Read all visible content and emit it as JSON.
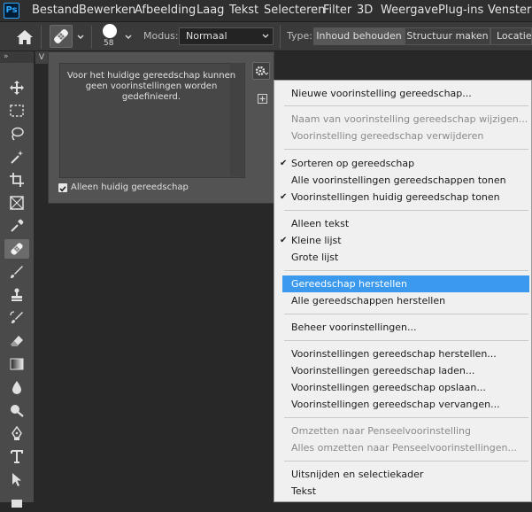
{
  "app": {
    "logo": "Ps"
  },
  "menubar": {
    "items": [
      "Bestand",
      "Bewerken",
      "Afbeelding",
      "Laag",
      "Tekst",
      "Selecteren",
      "Filter",
      "3D",
      "Weergave",
      "Plug-ins",
      "Venster"
    ]
  },
  "options": {
    "brush_size": "58",
    "mode_label": "Modus:",
    "mode_value": "Normaal",
    "type_label": "Type:",
    "type_buttons": [
      "Inhoud behouden",
      "Structuur maken",
      "Locatie a"
    ]
  },
  "toolbar": {
    "collapse_glyph": "»",
    "doc_tab_glyph": "V"
  },
  "preset_panel": {
    "message": "Voor het huidige gereedschap kunnen geen voorinstellingen worden gedefinieerd.",
    "checkbox_label": "Alleen huidig gereedschap",
    "checkbox_checked": true
  },
  "context_menu": {
    "items": [
      {
        "label": "Nieuwe voorinstelling gereedschap...",
        "disabled": false,
        "checked": false,
        "highlighted": false
      },
      {
        "label": "Naam van voorinstelling gereedschap wijzigen...",
        "disabled": true,
        "checked": false,
        "highlighted": false
      },
      {
        "label": "Voorinstelling gereedschap verwijderen",
        "disabled": true,
        "checked": false,
        "highlighted": false
      },
      {
        "label": "Sorteren op gereedschap",
        "disabled": false,
        "checked": true,
        "highlighted": false
      },
      {
        "label": "Alle voorinstellingen gereedschappen tonen",
        "disabled": false,
        "checked": false,
        "highlighted": false
      },
      {
        "label": "Voorinstellingen huidig gereedschap tonen",
        "disabled": false,
        "checked": true,
        "highlighted": false
      },
      {
        "label": "Alleen tekst",
        "disabled": false,
        "checked": false,
        "highlighted": false
      },
      {
        "label": "Kleine lijst",
        "disabled": false,
        "checked": true,
        "highlighted": false
      },
      {
        "label": "Grote lijst",
        "disabled": false,
        "checked": false,
        "highlighted": false
      },
      {
        "label": "Gereedschap herstellen",
        "disabled": false,
        "checked": false,
        "highlighted": true
      },
      {
        "label": "Alle gereedschappen herstellen",
        "disabled": false,
        "checked": false,
        "highlighted": false
      },
      {
        "label": "Beheer voorinstellingen...",
        "disabled": false,
        "checked": false,
        "highlighted": false
      },
      {
        "label": "Voorinstellingen gereedschap herstellen...",
        "disabled": false,
        "checked": false,
        "highlighted": false
      },
      {
        "label": "Voorinstellingen gereedschap laden...",
        "disabled": false,
        "checked": false,
        "highlighted": false
      },
      {
        "label": "Voorinstellingen gereedschap opslaan...",
        "disabled": false,
        "checked": false,
        "highlighted": false
      },
      {
        "label": "Voorinstellingen gereedschap vervangen...",
        "disabled": false,
        "checked": false,
        "highlighted": false
      },
      {
        "label": "Omzetten naar Penseelvoorinstelling",
        "disabled": true,
        "checked": false,
        "highlighted": false
      },
      {
        "label": "Alles omzetten naar Penseelvoorinstellingen...",
        "disabled": true,
        "checked": false,
        "highlighted": false
      },
      {
        "label": "Uitsnijden en selectiekader",
        "disabled": false,
        "checked": false,
        "highlighted": false
      },
      {
        "label": "Tekst",
        "disabled": false,
        "checked": false,
        "highlighted": false
      }
    ],
    "check_glyph": "✔",
    "highlight_color": "#3b9aee"
  }
}
